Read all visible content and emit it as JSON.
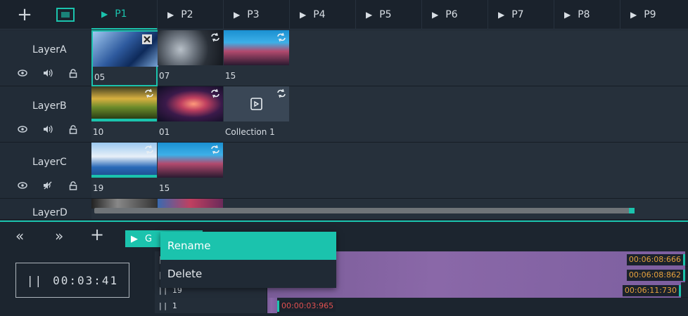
{
  "toolbar": {
    "add_icon": "plus-icon",
    "fit_icon": "fit-screen-icon"
  },
  "tabs": [
    {
      "label": "P1"
    },
    {
      "label": "P2"
    },
    {
      "label": "P3"
    },
    {
      "label": "P4"
    },
    {
      "label": "P5"
    },
    {
      "label": "P6"
    },
    {
      "label": "P7"
    },
    {
      "label": "P8"
    },
    {
      "label": "P9"
    }
  ],
  "layers": [
    {
      "name": "LayerA",
      "audio": "speaker-icon"
    },
    {
      "name": "LayerB",
      "audio": "speaker-icon"
    },
    {
      "name": "LayerC",
      "audio": "speaker-muted-icon"
    },
    {
      "name": "LayerD"
    }
  ],
  "clips": {
    "layerA": [
      {
        "label": "05"
      },
      {
        "label": "07"
      },
      {
        "label": "15"
      }
    ],
    "layerB": [
      {
        "label": "10"
      },
      {
        "label": "01"
      },
      {
        "label": "Collection 1"
      }
    ],
    "layerC": [
      {
        "label": "19"
      },
      {
        "label": "15"
      }
    ]
  },
  "bottom": {
    "prev": "«",
    "next": "»",
    "add": "+",
    "sequence_label": "G",
    "time": "00:03:41",
    "pause_glyph": "||"
  },
  "tracks": [
    {
      "name": "",
      "duration": "00:06:08:666"
    },
    {
      "name": "",
      "duration": "00:06:08:862"
    },
    {
      "name": "19",
      "duration": "00:06:11:730"
    },
    {
      "name": "1",
      "duration": "00:00:03:965"
    }
  ],
  "context_menu": {
    "rename": "Rename",
    "delete": "Delete"
  },
  "colors": {
    "accent": "#1bc3ad",
    "clip_bar": "#7a5c98",
    "duration_text": "#e6a23c",
    "duration_red": "#e05050"
  }
}
